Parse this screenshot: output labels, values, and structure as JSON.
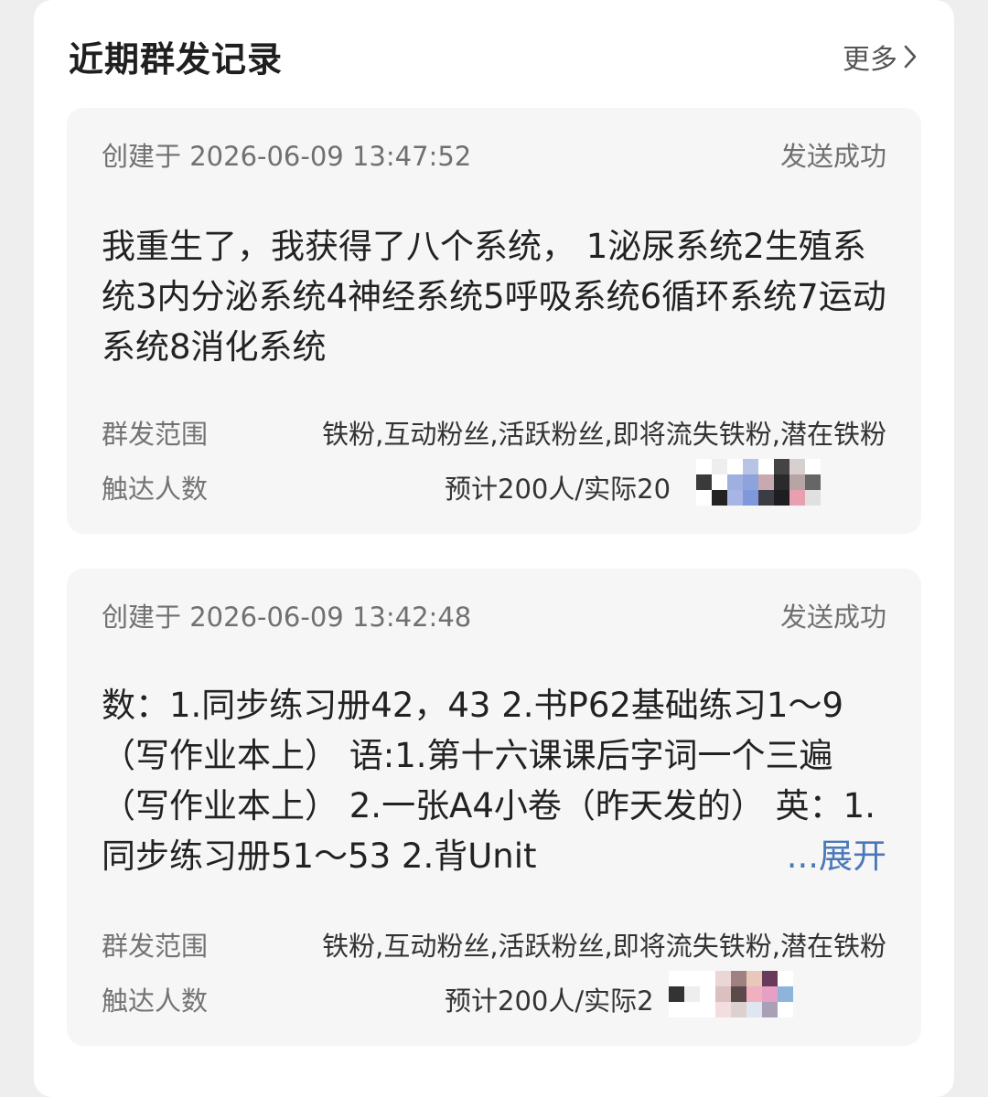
{
  "section": {
    "title": "近期群发记录",
    "more_label": "更多"
  },
  "records": [
    {
      "created": "创建于 2026-06-09 13:47:52",
      "status": "发送成功",
      "content": "我重生了，我获得了八个系统， 1泌尿系统2生殖系统3内分泌系统4神经系统5呼吸系统6循环系统7运动系统8消化系统",
      "scope_label": "群发范围",
      "scope_value": "铁粉,互动粉丝,活跃粉丝,即将流失铁粉,潜在铁粉",
      "reach_label": "触达人数",
      "reach_value": "预计200人/实际20"
    },
    {
      "created": "创建于 2026-06-09 13:42:48",
      "status": "发送成功",
      "content": "数：1.同步练习册42，43 2.书P62基础练习1～9（写作业本上） 语:1.第十六课课后字词一个三遍（写作业本上） 2.一张A4小卷（昨天发的） 英：1.同步练习册51～53 2.背Unit",
      "expand_label": "...展开",
      "scope_label": "群发范围",
      "scope_value": "铁粉,互动粉丝,活跃粉丝,即将流失铁粉,潜在铁粉",
      "reach_label": "触达人数",
      "reach_value": "预计200人/实际2"
    }
  ],
  "colors": {
    "background": "#eeeeef",
    "panel": "#ffffff",
    "card": "#f6f6f7",
    "expand_link": "#4a78b8",
    "muted_text": "#707070"
  },
  "icons": [
    "chevron-right-icon"
  ]
}
